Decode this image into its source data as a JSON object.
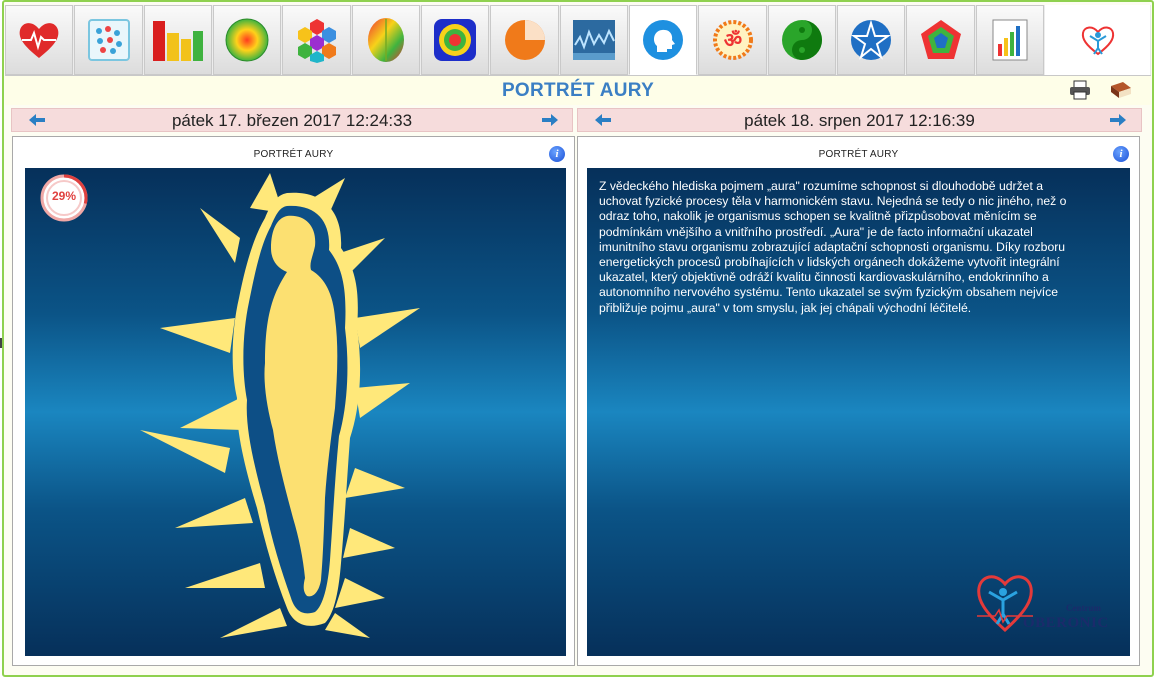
{
  "toolbar": {
    "tabs": [
      {
        "icon": "heart-ecg-icon"
      },
      {
        "icon": "dots-grid-icon"
      },
      {
        "icon": "bar-chart-icon"
      },
      {
        "icon": "radial-gradient-circle-icon"
      },
      {
        "icon": "hexagon-cluster-icon"
      },
      {
        "icon": "brain-map-icon"
      },
      {
        "icon": "chakra-figure-icon"
      },
      {
        "icon": "pie-chart-icon"
      },
      {
        "icon": "wave-chart-icon"
      },
      {
        "icon": "head-profile-icon",
        "active": true
      },
      {
        "icon": "om-symbol-icon"
      },
      {
        "icon": "yin-yang-icon"
      },
      {
        "icon": "pentagram-icon"
      },
      {
        "icon": "pentagon-radar-icon"
      },
      {
        "icon": "report-chart-icon"
      },
      {
        "icon": "oberon-logo-icon"
      }
    ]
  },
  "header": {
    "title": "PORTRÉT AURY",
    "print_icon": "printer-icon",
    "book_icon": "book-icon"
  },
  "left": {
    "date": "pátek 17. březen 2017 12:24:33",
    "panel_title": "PORTRÉT AURY",
    "percent": "29%",
    "percent_value": 0.29
  },
  "right": {
    "date": "pátek 18. srpen 2017 12:16:39",
    "panel_title": "PORTRÉT AURY",
    "description": "Z vědeckého hlediska pojmem „aura\" rozumíme schopnost si dlouhodobě udržet a uchovat fyzické procesy těla v harmonickém stavu. Nejedná se tedy o nic jiného, než o odraz toho, nakolik je organismus schopen se kvalitně přizpůsobovat měnícím se podmínkám vnějšího a vnitřního prostředí. „Aura\" je de facto informační ukazatel imunitního stavu organismu zobrazující adaptační schopnosti organismu. Díky rozboru energetických procesů probíhajících v lidských orgánech dokážeme vytvořit integrální ukazatel, který objektivně odráží kvalitu činnosti kardiovaskulárního, endokrinního a autonomního nervového systému. Tento ukazatel se svým fyzickým obsahem nejvíce přibližuje pojmu „aura\" v tom smyslu, jak jej chápali východní léčitelé.",
    "logo_line1": "Centrum",
    "logo_line2": "OBERONIC"
  },
  "colors": {
    "accent": "#3b7fc4",
    "aura": "#ffe87a",
    "silhouette": "#fce071",
    "canvas": "#0b5487",
    "badge": "#e0413f"
  }
}
